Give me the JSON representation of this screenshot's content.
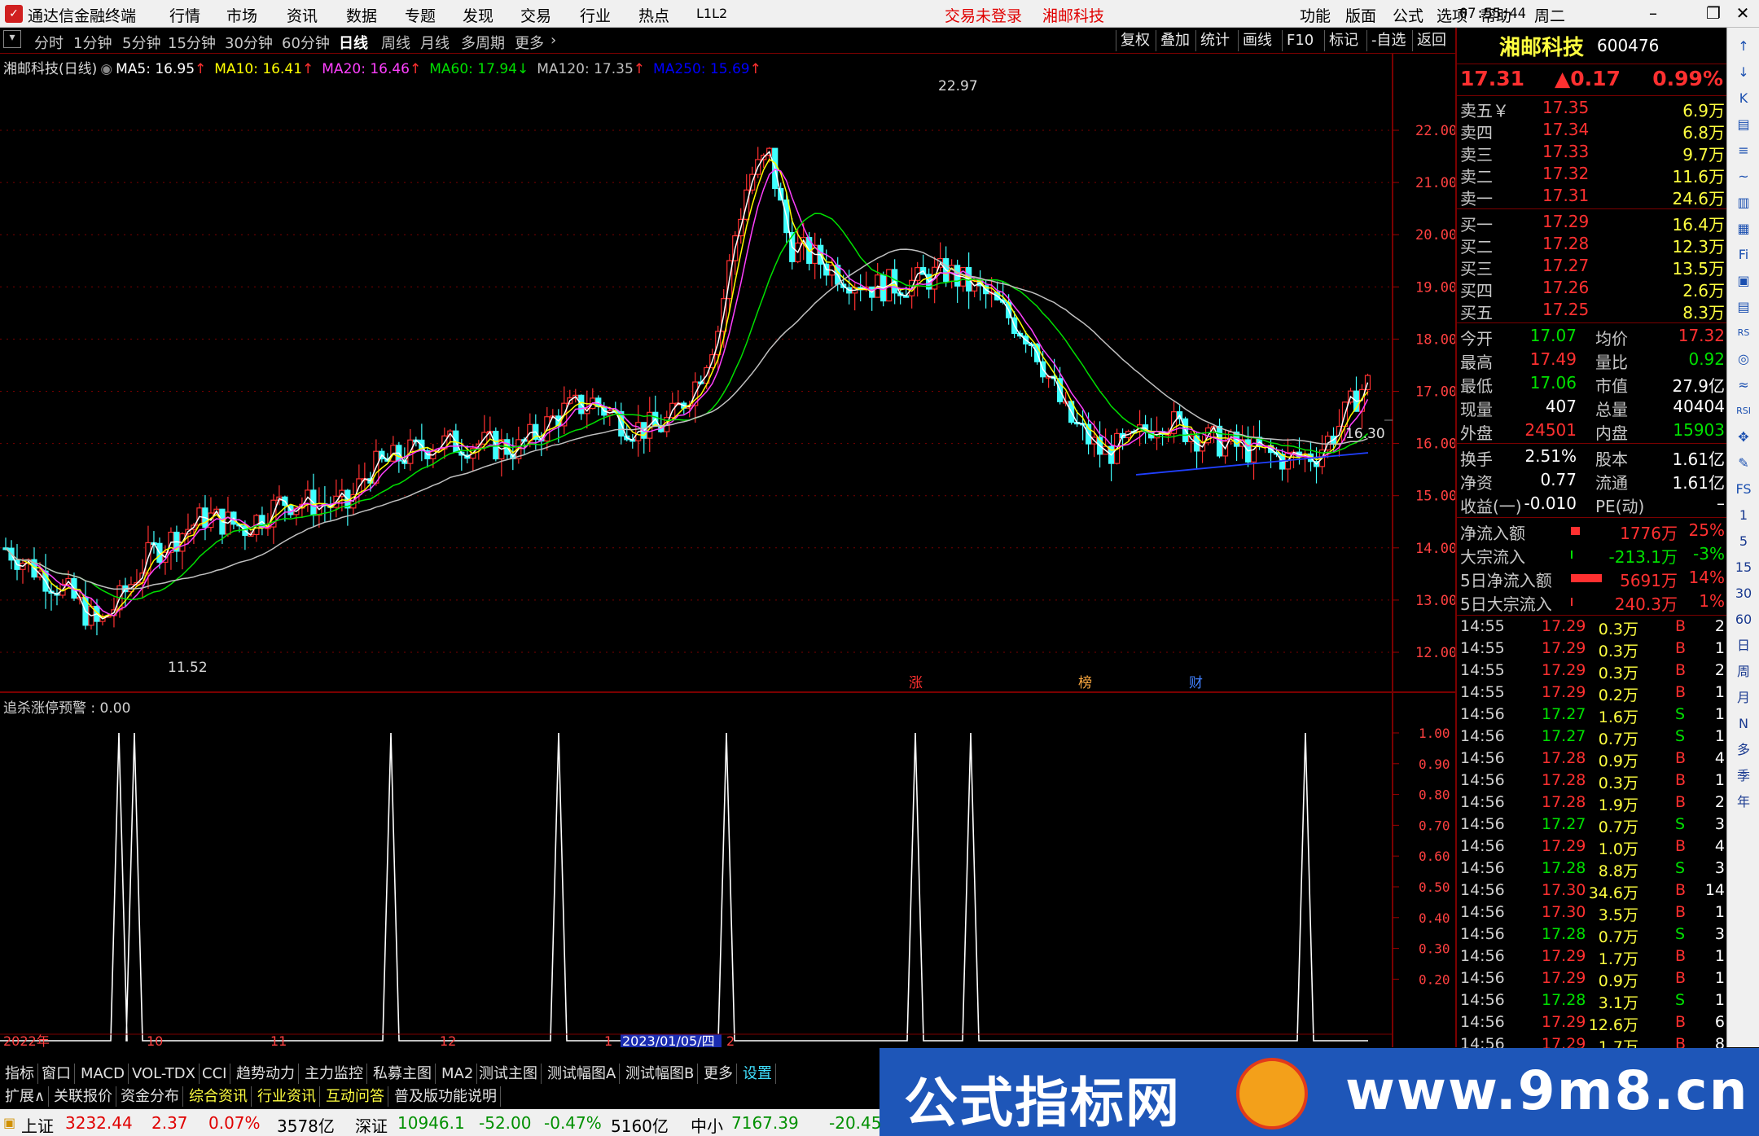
{
  "app": {
    "title": "通达信金融终端",
    "menu": [
      "行情",
      "市场",
      "资讯",
      "数据",
      "专题",
      "发现",
      "交易",
      "行业",
      "热点",
      "L1L2"
    ],
    "login_status": "交易未登录",
    "stock_title": "湘邮科技",
    "right_menu": [
      "功能",
      "版面",
      "公式",
      "选项",
      "帮助"
    ],
    "time": "07:55:44",
    "weekday": "周二"
  },
  "toolbar": {
    "periods": [
      "分时",
      "1分钟",
      "5分钟",
      "15分钟",
      "30分钟",
      "60分钟",
      "日线",
      "周线",
      "月线",
      "多周期",
      "更多"
    ],
    "active_period": "日线",
    "more_arrow": "›",
    "right_buttons": [
      "复权",
      "叠加",
      "统计",
      "画线",
      "F10",
      "标记",
      "-自选",
      "返回"
    ]
  },
  "chart": {
    "stock_label": "湘邮科技(日线)",
    "ma": [
      {
        "label": "MA5: 16.95",
        "arrow": "↑",
        "color": "#ffffff",
        "arrow_color": "#ff3030"
      },
      {
        "label": "MA10: 16.41",
        "arrow": "↑",
        "color": "#ffff00",
        "arrow_color": "#ff3030"
      },
      {
        "label": "MA20: 16.46",
        "arrow": "↑",
        "color": "#ff40ff",
        "arrow_color": "#ff3030"
      },
      {
        "label": "MA60: 17.94",
        "arrow": "↓",
        "color": "#00e000",
        "arrow_color": "#00e000"
      },
      {
        "label": "MA120: 17.35",
        "arrow": "↑",
        "color": "#c0c0c0",
        "arrow_color": "#ff3030"
      },
      {
        "label": "MA250: 15.69",
        "arrow": "↑",
        "color": "#0000ff",
        "arrow_color": "#ff3030"
      }
    ],
    "y_ticks": [
      "22.00",
      "21.00",
      "20.00",
      "19.00",
      "18.00",
      "17.00",
      "16.00",
      "15.00",
      "14.00",
      "13.00",
      "12.00"
    ],
    "high_label": "22.97",
    "low_label": "11.52",
    "cursor_price": "16.30",
    "markers": [
      {
        "text": "涨",
        "color": "#ff3030"
      },
      {
        "text": "榜",
        "color": "#ffaa40"
      },
      {
        "text": "财",
        "color": "#4080ff"
      }
    ],
    "sub_title": "追杀涨停预警 : 0.00",
    "sub_y_ticks": [
      "1.00",
      "0.90",
      "0.80",
      "0.70",
      "0.60",
      "0.50",
      "0.40",
      "0.30",
      "0.20"
    ],
    "x_labels": [
      "2022年",
      "10",
      "11",
      "12",
      "1",
      "2023/01/05/四",
      "2"
    ],
    "colors": {
      "up": "#ff3030",
      "down": "#40ffff",
      "grid": "#7a0000"
    }
  },
  "quote": {
    "name": "湘邮科技",
    "code": "600476",
    "price": "17.31",
    "change": "▲0.17",
    "pct": "0.99%",
    "asks": [
      {
        "label": "卖五￥",
        "price": "17.35",
        "vol": "6.9万"
      },
      {
        "label": "卖四",
        "price": "17.34",
        "vol": "6.8万"
      },
      {
        "label": "卖三",
        "price": "17.33",
        "vol": "9.7万"
      },
      {
        "label": "卖二",
        "price": "17.32",
        "vol": "11.6万"
      },
      {
        "label": "卖一",
        "price": "17.31",
        "vol": "24.6万"
      }
    ],
    "bids": [
      {
        "label": "买一",
        "price": "17.29",
        "vol": "16.4万"
      },
      {
        "label": "买二",
        "price": "17.28",
        "vol": "12.3万"
      },
      {
        "label": "买三",
        "price": "17.27",
        "vol": "13.5万"
      },
      {
        "label": "买四",
        "price": "17.26",
        "vol": "2.6万"
      },
      {
        "label": "买五",
        "price": "17.25",
        "vol": "8.3万"
      }
    ],
    "stats1": [
      {
        "l1": "今开",
        "v1": "17.07",
        "c1": "green",
        "l2": "均价",
        "v2": "17.32",
        "c2": "red"
      },
      {
        "l1": "最高",
        "v1": "17.49",
        "c1": "red",
        "l2": "量比",
        "v2": "0.92",
        "c2": "green"
      },
      {
        "l1": "最低",
        "v1": "17.06",
        "c1": "green",
        "l2": "市值",
        "v2": "27.9亿",
        "c2": "white"
      },
      {
        "l1": "现量",
        "v1": "407",
        "c1": "white",
        "l2": "总量",
        "v2": "40404",
        "c2": "white"
      },
      {
        "l1": "外盘",
        "v1": "24501",
        "c1": "red",
        "l2": "内盘",
        "v2": "15903",
        "c2": "green"
      }
    ],
    "stats2": [
      {
        "l1": "换手",
        "v1": "2.51%",
        "c1": "white",
        "l2": "股本",
        "v2": "1.61亿",
        "c2": "white"
      },
      {
        "l1": "净资",
        "v1": "0.77",
        "c1": "white",
        "l2": "流通",
        "v2": "1.61亿",
        "c2": "white"
      },
      {
        "l1": "收益(一)",
        "v1": "-0.010",
        "c1": "white",
        "l2": "PE(动)",
        "v2": "–",
        "c2": "white"
      }
    ],
    "flows": [
      {
        "label": "净流入额",
        "value": "1776万",
        "pct": "25%",
        "color": "red",
        "bar": 0.25
      },
      {
        "label": "大宗流入",
        "value": "-213.1万",
        "pct": "-3%",
        "color": "green",
        "bar": 0.03
      },
      {
        "label": "5日净流入额",
        "value": "5691万",
        "pct": "14%",
        "color": "red",
        "bar": 0.9
      },
      {
        "label": "5日大宗流入",
        "value": "240.3万",
        "pct": "1%",
        "color": "red",
        "bar": 0.02
      }
    ],
    "ticks": [
      {
        "t": "14:55",
        "p": "17.29",
        "v": "0.3万",
        "s": "B",
        "n": "2"
      },
      {
        "t": "14:55",
        "p": "17.29",
        "v": "0.3万",
        "s": "B",
        "n": "1"
      },
      {
        "t": "14:55",
        "p": "17.29",
        "v": "0.3万",
        "s": "B",
        "n": "2"
      },
      {
        "t": "14:55",
        "p": "17.29",
        "v": "0.2万",
        "s": "B",
        "n": "1"
      },
      {
        "t": "14:56",
        "p": "17.27",
        "v": "1.6万",
        "s": "S",
        "n": "1"
      },
      {
        "t": "14:56",
        "p": "17.27",
        "v": "0.7万",
        "s": "S",
        "n": "1"
      },
      {
        "t": "14:56",
        "p": "17.28",
        "v": "0.9万",
        "s": "B",
        "n": "4"
      },
      {
        "t": "14:56",
        "p": "17.28",
        "v": "0.3万",
        "s": "B",
        "n": "1"
      },
      {
        "t": "14:56",
        "p": "17.28",
        "v": "1.9万",
        "s": "B",
        "n": "2"
      },
      {
        "t": "14:56",
        "p": "17.27",
        "v": "0.7万",
        "s": "S",
        "n": "3"
      },
      {
        "t": "14:56",
        "p": "17.29",
        "v": "1.0万",
        "s": "B",
        "n": "4"
      },
      {
        "t": "14:56",
        "p": "17.28",
        "v": "8.8万",
        "s": "S",
        "n": "3"
      },
      {
        "t": "14:56",
        "p": "17.30",
        "v": "34.6万",
        "s": "B",
        "n": "14"
      },
      {
        "t": "14:56",
        "p": "17.30",
        "v": "3.5万",
        "s": "B",
        "n": "1"
      },
      {
        "t": "14:56",
        "p": "17.28",
        "v": "0.7万",
        "s": "S",
        "n": "3"
      },
      {
        "t": "14:56",
        "p": "17.29",
        "v": "1.7万",
        "s": "B",
        "n": "1"
      },
      {
        "t": "14:56",
        "p": "17.29",
        "v": "0.9万",
        "s": "B",
        "n": "1"
      },
      {
        "t": "14:56",
        "p": "17.28",
        "v": "3.1万",
        "s": "S",
        "n": "1"
      },
      {
        "t": "14:56",
        "p": "17.29",
        "v": "12.6万",
        "s": "B",
        "n": "6"
      },
      {
        "t": "14:56",
        "p": "17.29",
        "v": "1.7万",
        "s": "B",
        "n": "8"
      }
    ]
  },
  "icon_strip": [
    "↑",
    "↓",
    "K",
    "▤",
    "≡",
    "~",
    "▥",
    "▦",
    "Fi",
    "▣",
    "▤",
    "RS",
    "◎",
    "≈",
    "RSI",
    "✥",
    "✎",
    "FS",
    "1",
    "5",
    "15",
    "30",
    "60",
    "日",
    "周",
    "月",
    "N",
    "多",
    "季",
    "年"
  ],
  "bottom": {
    "tabs1": [
      {
        "t": "指标",
        "c": ""
      },
      {
        "t": "窗口",
        "c": ""
      },
      {
        "t": "MACD",
        "c": ""
      },
      {
        "t": "VOL-TDX",
        "c": ""
      },
      {
        "t": "CCI",
        "c": ""
      },
      {
        "t": "趋势动力",
        "c": ""
      },
      {
        "t": "主力监控",
        "c": ""
      },
      {
        "t": "私募主图",
        "c": ""
      },
      {
        "t": "MA2",
        "c": ""
      },
      {
        "t": "测试主图",
        "c": ""
      },
      {
        "t": "测试幅图A",
        "c": ""
      },
      {
        "t": "测试幅图B",
        "c": ""
      },
      {
        "t": "更多",
        "c": ""
      },
      {
        "t": "设置",
        "c": "cy"
      }
    ],
    "tabs2": [
      {
        "t": "扩展∧",
        "c": ""
      },
      {
        "t": "关联报价",
        "c": ""
      },
      {
        "t": "资金分布",
        "c": ""
      },
      {
        "t": "综合资讯",
        "c": "yel"
      },
      {
        "t": "行业资讯",
        "c": "yel"
      },
      {
        "t": "互动问答",
        "c": "yel"
      },
      {
        "t": "普及版功能说明",
        "c": ""
      }
    ],
    "status": [
      {
        "t": "上证",
        "c": "#000"
      },
      {
        "t": "3232.44",
        "c": "#e00000"
      },
      {
        "t": "2.37",
        "c": "#e00000"
      },
      {
        "t": "0.07%",
        "c": "#e00000"
      },
      {
        "t": "3578亿",
        "c": "#000"
      },
      {
        "t": "深证",
        "c": "#000"
      },
      {
        "t": "10946.1",
        "c": "#009000"
      },
      {
        "t": "-52.00",
        "c": "#009000"
      },
      {
        "t": "-0.47%",
        "c": "#009000"
      },
      {
        "t": "5160亿",
        "c": "#000"
      },
      {
        "t": "中小",
        "c": "#000"
      },
      {
        "t": "7167.39",
        "c": "#009000"
      },
      {
        "t": "-20.45",
        "c": "#009000"
      }
    ]
  },
  "banner": {
    "left_text": "公式指标网",
    "right_text": "www.9m8.cn"
  }
}
